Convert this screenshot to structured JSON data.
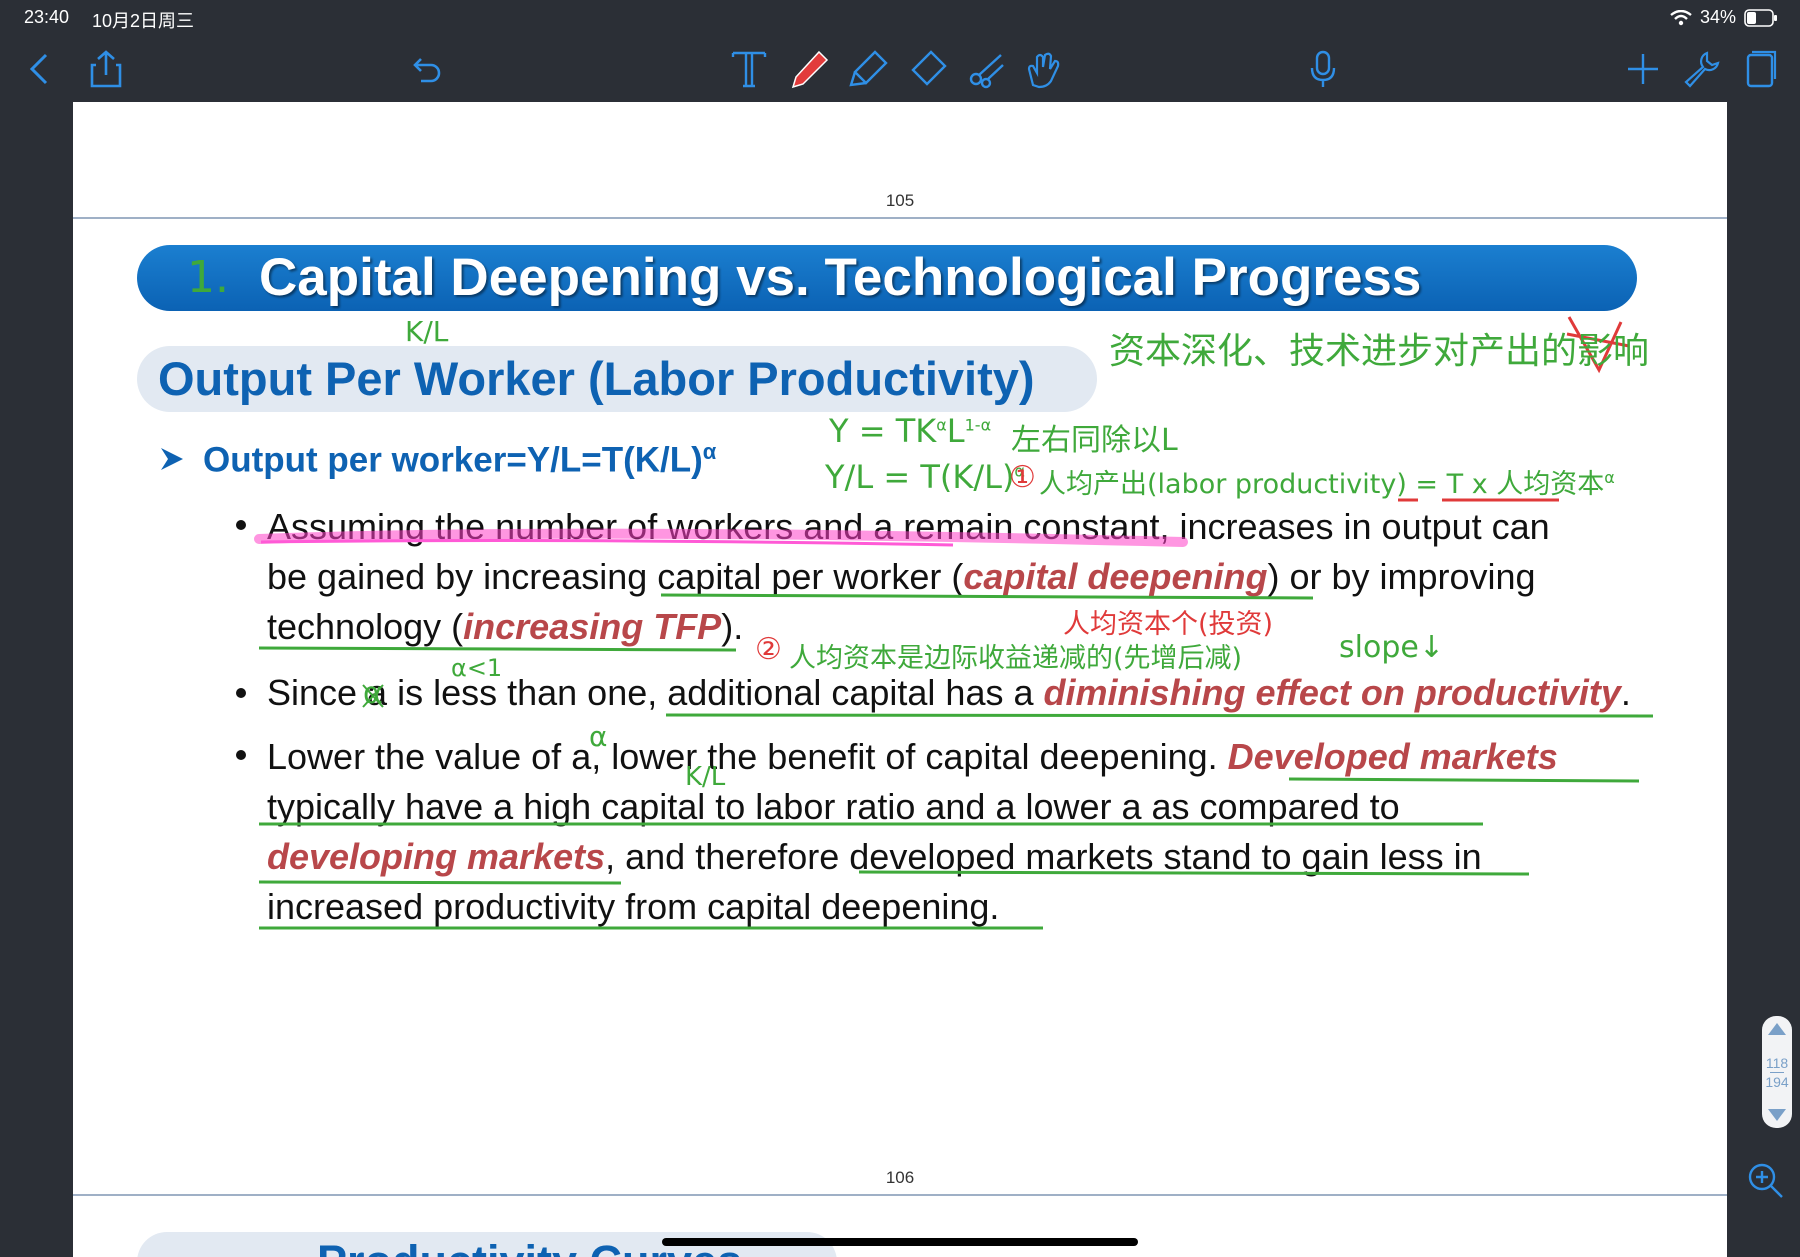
{
  "status": {
    "time": "23:40",
    "date": "10月2日周三",
    "battery": "34%"
  },
  "toolbar": {
    "icons": [
      "back-icon",
      "share-icon",
      "undo-icon",
      "text-tool-icon",
      "pen-icon",
      "highlighter-icon",
      "eraser-icon",
      "lasso-icon",
      "hand-icon",
      "microphone-icon",
      "add-icon",
      "wrench-icon",
      "pages-icon"
    ]
  },
  "page": {
    "page_top_number": "105",
    "page_bottom_number": "106",
    "banner_title": "Capital Deepening vs. Technological Progress",
    "subheading": "Output Per Worker (Labor Productivity)",
    "formula": "Output per worker=Y/L=T(K/L)",
    "formula_sup": "α",
    "bullets": [
      {
        "lines": [
          [
            "Assuming the number of workers and a remain constant, increases in output can"
          ],
          [
            "be gained by increasing capital per worker (",
            "capital deepening",
            ") or by improving"
          ],
          [
            "technology (",
            "increasing TFP",
            ")."
          ]
        ]
      },
      {
        "lines": [
          [
            "Since a is less than one, additional capital has a ",
            "diminishing effect on productivity",
            "."
          ]
        ]
      },
      {
        "lines": [
          [
            "Lower the value of a, lower the benefit of capital deepening. ",
            "Developed markets",
            ""
          ],
          [
            "typically have a high capital to labor ratio and a lower a as compared to"
          ],
          [
            "",
            "developing markets",
            ", and therefore developed markets stand to gain less in"
          ],
          [
            "increased productivity from capital deepening."
          ]
        ]
      }
    ],
    "next_page_banner": "Productivity Curves"
  },
  "handwriting": {
    "h1": "1.",
    "kl_1": "K/L",
    "cn_heading": "资本深化、技术进步对产出的影响",
    "eq1": "Y = TK",
    "eq1_sup": "α",
    "eq1_mid": "L",
    "eq1_sup2": "1-α",
    "eq1_note": "左右同除以L",
    "eq2": "Y/L = T(K/L)",
    "eq2_sup": "α",
    "circ1": "①",
    "note1": "人均产出(labor productivity) = T x 人均资本",
    "note1_sup": "α",
    "red_note_top": "人均资本个(投资)",
    "circ2": "②",
    "note2": "人均资本是边际收益递减的(先增后减)",
    "slope": "slope↓",
    "alpha_lt1": "α<1",
    "alpha_1": "α",
    "alpha_2": "α",
    "kl_2": "K/L"
  },
  "scroller": {
    "current": "118",
    "total": "194"
  }
}
